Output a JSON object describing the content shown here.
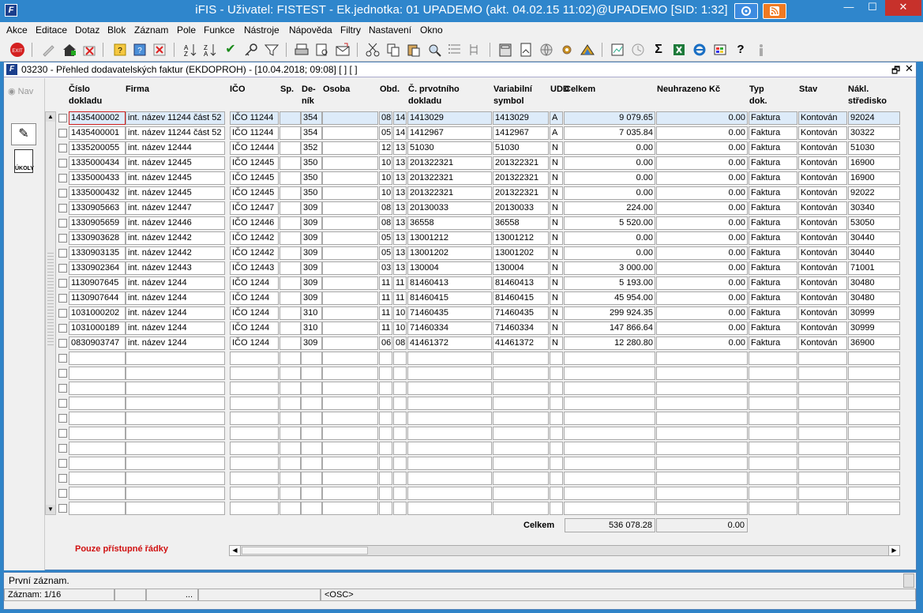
{
  "app": {
    "title": "iFIS - Uživatel: FISTEST - Ek.jednotka: 01 UPADEMO (akt. 04.02.15 11:02)@UPADEMO   [SID: 1:32]",
    "logo": "F",
    "win_min": "—",
    "win_max": "☐",
    "win_close": "✕"
  },
  "menu": [
    "Akce",
    "Editace",
    "Dotaz",
    "Blok",
    "Záznam",
    "Pole",
    "Funkce",
    "Nástroje",
    "Nápověda",
    "Filtry",
    "Nastavení",
    "Okno"
  ],
  "toolbar": {
    "icons": [
      "exit-icon",
      "pen-icon",
      "insert-record-icon",
      "delete-record-icon",
      "query-enter-icon",
      "query-exec-icon",
      "query-cancel-icon",
      "sort-asc-icon",
      "sort-desc-icon",
      "check-icon",
      "key-icon",
      "filter-icon",
      "print-icon",
      "print-preview-icon",
      "mail-icon",
      "cut-icon",
      "copy-icon",
      "paste-icon",
      "zoom-icon",
      "list-icon",
      "tree-icon",
      "calc-icon",
      "page-icon",
      "globe-icon",
      "gear-icon",
      "triangle-icon",
      "chart-icon",
      "clock-icon",
      "sigma-icon",
      "excel-icon",
      "ie-icon",
      "windows-icon",
      "help-icon",
      "info-icon"
    ],
    "exit_label": "EXIT",
    "check_glyph": "✔",
    "sigma_glyph": "Σ",
    "help_glyph": "?"
  },
  "window": {
    "title": "03230 - Přehled dodavatelských faktur (EKDOPROH) - [10.04.2018; 09:08]  [ ] [ ]",
    "logo": "F",
    "restore": "🗗",
    "close": "✕"
  },
  "nav": {
    "label": "Nav",
    "btn2_label": "ÚKOLY",
    "btn1_glyph": "✎"
  },
  "columns": {
    "cislo": "Číslo dokladu",
    "firma": "Firma",
    "ico": "IČO",
    "sp": "Sp.",
    "denik": "De-ník",
    "osoba": "Osoba",
    "obd": "Obd.",
    "prvotni": "Č. prvotního dokladu",
    "vs": "Variabilní symbol",
    "udd": "UDD",
    "celkem": "Celkem",
    "neuhr": "Neuhrazeno Kč",
    "typ": "Typ dok.",
    "stav": "Stav",
    "nakl": "Nákl. středisko"
  },
  "rows": [
    {
      "cislo": "1435400002",
      "firma": "int. název 11244 část 52",
      "ico": "IČO 11244",
      "sp": "",
      "denik": "354",
      "osoba": "",
      "ob": "08",
      "d": "14",
      "prvotni": "1413029",
      "vs": "1413029",
      "u": "A",
      "celkem": "9 079.65",
      "neuhr": "0.00",
      "typ": "Faktura",
      "stav": "Kontován",
      "nakl": "92024"
    },
    {
      "cislo": "1435400001",
      "firma": "int. název 11244 část 52",
      "ico": "IČO 11244",
      "sp": "",
      "denik": "354",
      "osoba": "",
      "ob": "05",
      "d": "14",
      "prvotni": "1412967",
      "vs": "1412967",
      "u": "A",
      "celkem": "7 035.84",
      "neuhr": "0.00",
      "typ": "Faktura",
      "stav": "Kontován",
      "nakl": "30322"
    },
    {
      "cislo": "1335200055",
      "firma": "int. název 12444",
      "ico": "IČO 12444",
      "sp": "",
      "denik": "352",
      "osoba": "",
      "ob": "12",
      "d": "13",
      "prvotni": "51030",
      "vs": "51030",
      "u": "N",
      "celkem": "0.00",
      "neuhr": "0.00",
      "typ": "Faktura",
      "stav": "Kontován",
      "nakl": "51030"
    },
    {
      "cislo": "1335000434",
      "firma": "int. název 12445",
      "ico": "IČO 12445",
      "sp": "",
      "denik": "350",
      "osoba": "",
      "ob": "10",
      "d": "13",
      "prvotni": "201322321",
      "vs": "201322321",
      "u": "N",
      "celkem": "0.00",
      "neuhr": "0.00",
      "typ": "Faktura",
      "stav": "Kontován",
      "nakl": "16900"
    },
    {
      "cislo": "1335000433",
      "firma": "int. název 12445",
      "ico": "IČO 12445",
      "sp": "",
      "denik": "350",
      "osoba": "",
      "ob": "10",
      "d": "13",
      "prvotni": "201322321",
      "vs": "201322321",
      "u": "N",
      "celkem": "0.00",
      "neuhr": "0.00",
      "typ": "Faktura",
      "stav": "Kontován",
      "nakl": "16900"
    },
    {
      "cislo": "1335000432",
      "firma": "int. název 12445",
      "ico": "IČO 12445",
      "sp": "",
      "denik": "350",
      "osoba": "",
      "ob": "10",
      "d": "13",
      "prvotni": "201322321",
      "vs": "201322321",
      "u": "N",
      "celkem": "0.00",
      "neuhr": "0.00",
      "typ": "Faktura",
      "stav": "Kontován",
      "nakl": "92022"
    },
    {
      "cislo": "1330905663",
      "firma": "int. název 12447",
      "ico": "IČO 12447",
      "sp": "",
      "denik": "309",
      "osoba": "",
      "ob": "08",
      "d": "13",
      "prvotni": "20130033",
      "vs": "20130033",
      "u": "N",
      "celkem": "224.00",
      "neuhr": "0.00",
      "typ": "Faktura",
      "stav": "Kontován",
      "nakl": "30340"
    },
    {
      "cislo": "1330905659",
      "firma": "int. název 12446",
      "ico": "IČO 12446",
      "sp": "",
      "denik": "309",
      "osoba": "",
      "ob": "08",
      "d": "13",
      "prvotni": "36558",
      "vs": "36558",
      "u": "N",
      "celkem": "5 520.00",
      "neuhr": "0.00",
      "typ": "Faktura",
      "stav": "Kontován",
      "nakl": "53050"
    },
    {
      "cislo": "1330903628",
      "firma": "int. název 12442",
      "ico": "IČO 12442",
      "sp": "",
      "denik": "309",
      "osoba": "",
      "ob": "05",
      "d": "13",
      "prvotni": "13001212",
      "vs": "13001212",
      "u": "N",
      "celkem": "0.00",
      "neuhr": "0.00",
      "typ": "Faktura",
      "stav": "Kontován",
      "nakl": "30440"
    },
    {
      "cislo": "1330903135",
      "firma": "int. název 12442",
      "ico": "IČO 12442",
      "sp": "",
      "denik": "309",
      "osoba": "",
      "ob": "05",
      "d": "13",
      "prvotni": "13001202",
      "vs": "13001202",
      "u": "N",
      "celkem": "0.00",
      "neuhr": "0.00",
      "typ": "Faktura",
      "stav": "Kontován",
      "nakl": "30440"
    },
    {
      "cislo": "1330902364",
      "firma": "int. název 12443",
      "ico": "IČO 12443",
      "sp": "",
      "denik": "309",
      "osoba": "",
      "ob": "03",
      "d": "13",
      "prvotni": "130004",
      "vs": "130004",
      "u": "N",
      "celkem": "3 000.00",
      "neuhr": "0.00",
      "typ": "Faktura",
      "stav": "Kontován",
      "nakl": "71001"
    },
    {
      "cislo": "1130907645",
      "firma": "int. název 1244",
      "ico": "IČO 1244",
      "sp": "",
      "denik": "309",
      "osoba": "",
      "ob": "11",
      "d": "11",
      "prvotni": "81460413",
      "vs": "81460413",
      "u": "N",
      "celkem": "5 193.00",
      "neuhr": "0.00",
      "typ": "Faktura",
      "stav": "Kontován",
      "nakl": "30480"
    },
    {
      "cislo": "1130907644",
      "firma": "int. název 1244",
      "ico": "IČO 1244",
      "sp": "",
      "denik": "309",
      "osoba": "",
      "ob": "11",
      "d": "11",
      "prvotni": "81460415",
      "vs": "81460415",
      "u": "N",
      "celkem": "45 954.00",
      "neuhr": "0.00",
      "typ": "Faktura",
      "stav": "Kontován",
      "nakl": "30480"
    },
    {
      "cislo": "1031000202",
      "firma": "int. název 1244",
      "ico": "IČO 1244",
      "sp": "",
      "denik": "310",
      "osoba": "",
      "ob": "11",
      "d": "10",
      "prvotni": "71460435",
      "vs": "71460435",
      "u": "N",
      "celkem": "299 924.35",
      "neuhr": "0.00",
      "typ": "Faktura",
      "stav": "Kontován",
      "nakl": "30999"
    },
    {
      "cislo": "1031000189",
      "firma": "int. název 1244",
      "ico": "IČO 1244",
      "sp": "",
      "denik": "310",
      "osoba": "",
      "ob": "11",
      "d": "10",
      "prvotni": "71460334",
      "vs": "71460334",
      "u": "N",
      "celkem": "147 866.64",
      "neuhr": "0.00",
      "typ": "Faktura",
      "stav": "Kontován",
      "nakl": "30999"
    },
    {
      "cislo": "0830903747",
      "firma": "int. název 1244",
      "ico": "IČO 1244",
      "sp": "",
      "denik": "309",
      "osoba": "",
      "ob": "06",
      "d": "08",
      "prvotni": "41461372",
      "vs": "41461372",
      "u": "N",
      "celkem": "12 280.80",
      "neuhr": "0.00",
      "typ": "Faktura",
      "stav": "Kontován",
      "nakl": "36900"
    }
  ],
  "empty_rows": 11,
  "totals": {
    "label": "Celkem",
    "celkem": "536 078.28",
    "neuhr": "0.00"
  },
  "access_note": "Pouze přístupné řádky",
  "status": {
    "message": "První záznam.",
    "record": "Záznam: 1/16",
    "dots": "...",
    "osc": "<OSC>"
  },
  "colors": {
    "titlebar": "#2f86cc",
    "selected_row": "#ddebf9",
    "focus": "#d02020",
    "note": "#d01010"
  }
}
